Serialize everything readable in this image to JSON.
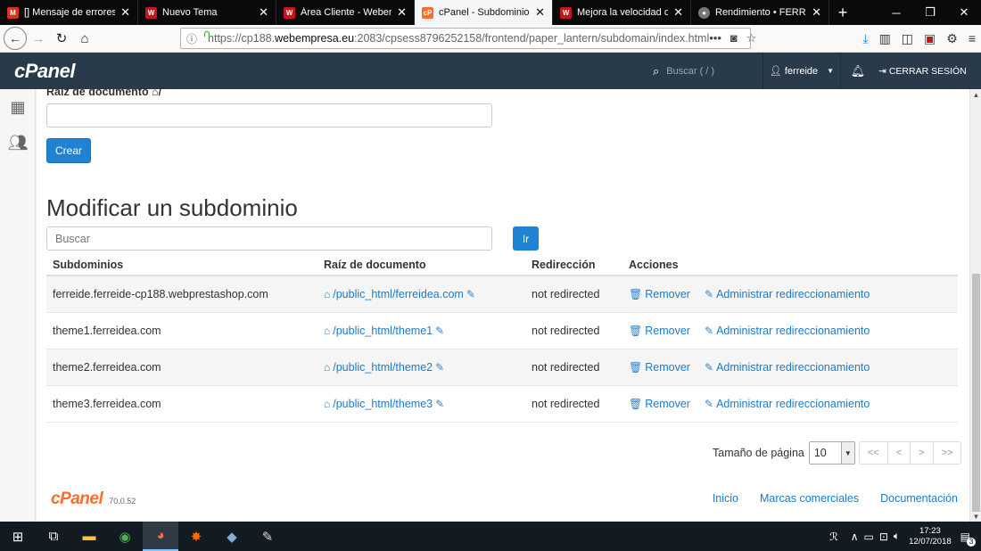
{
  "browser": {
    "tabs": [
      {
        "title": "[] Mensaje de errores en ",
        "icon": "gmail-icon",
        "color": "#d93025",
        "active": false
      },
      {
        "title": "Nuevo Tema",
        "icon": "webempresa-icon",
        "color": "#c4161c",
        "active": false
      },
      {
        "title": "Área Cliente - Webempr",
        "icon": "webempresa-icon",
        "color": "#c4161c",
        "active": false
      },
      {
        "title": "cPanel - Subdominios",
        "icon": "cpanel-icon",
        "color": "#ff6c2c",
        "active": true
      },
      {
        "title": "Mejora la velocidad de tu",
        "icon": "webempresa-icon",
        "color": "#c4161c",
        "active": false
      },
      {
        "title": "Rendimiento • FERREIDEA",
        "icon": "chrome-icon",
        "color": "#777777",
        "active": false
      }
    ],
    "url_prefix": "https://cp188.",
    "url_host": "webempresa.eu",
    "url_rest": ":2083/cpsess8796252158/frontend/paper_lantern/subdomain/index.html"
  },
  "cpanel": {
    "logo": "cPanel",
    "search_placeholder": "Buscar ( / )",
    "user": "ferreide",
    "logout": "CERRAR SESIÓN"
  },
  "form": {
    "root_label": "Raíz de documento",
    "root_suffix": "/",
    "create_button": "Crear"
  },
  "modify": {
    "heading": "Modificar un subdominio",
    "search_placeholder": "Buscar",
    "go_button": "Ir",
    "columns": [
      "Subdominios",
      "Raíz de documento",
      "Redirección",
      "Acciones"
    ],
    "rows": [
      {
        "subdomain": "ferreide.ferreide-cp188.webprestashop.com",
        "root": "/public_html/ferreidea.com",
        "redirect": "not redirected",
        "remove": "Remover",
        "manage": "Administrar redireccionamiento"
      },
      {
        "subdomain": "theme1.ferreidea.com",
        "root": "/public_html/theme1",
        "redirect": "not redirected",
        "remove": "Remover",
        "manage": "Administrar redireccionamiento"
      },
      {
        "subdomain": "theme2.ferreidea.com",
        "root": "/public_html/theme2",
        "redirect": "not redirected",
        "remove": "Remover",
        "manage": "Administrar redireccionamiento"
      },
      {
        "subdomain": "theme3.ferreidea.com",
        "root": "/public_html/theme3",
        "redirect": "not redirected",
        "remove": "Remover",
        "manage": "Administrar redireccionamiento"
      }
    ],
    "page_size_label": "Tamaño de página",
    "page_size": "10",
    "pager": [
      "<<",
      "<",
      ">",
      ">>"
    ]
  },
  "footer": {
    "logo": "cPanel",
    "version": "70.0.52",
    "links": [
      "Inicio",
      "Marcas comerciales",
      "Documentación"
    ]
  },
  "taskbar": {
    "time": "17:23",
    "date": "12/07/2018",
    "notifications": "3"
  },
  "colors": {
    "primary": "#1f82d2",
    "link": "#1f7ac6",
    "cpanel_bar": "#293a4a",
    "cpanel_orange": "#ff6c2c"
  }
}
